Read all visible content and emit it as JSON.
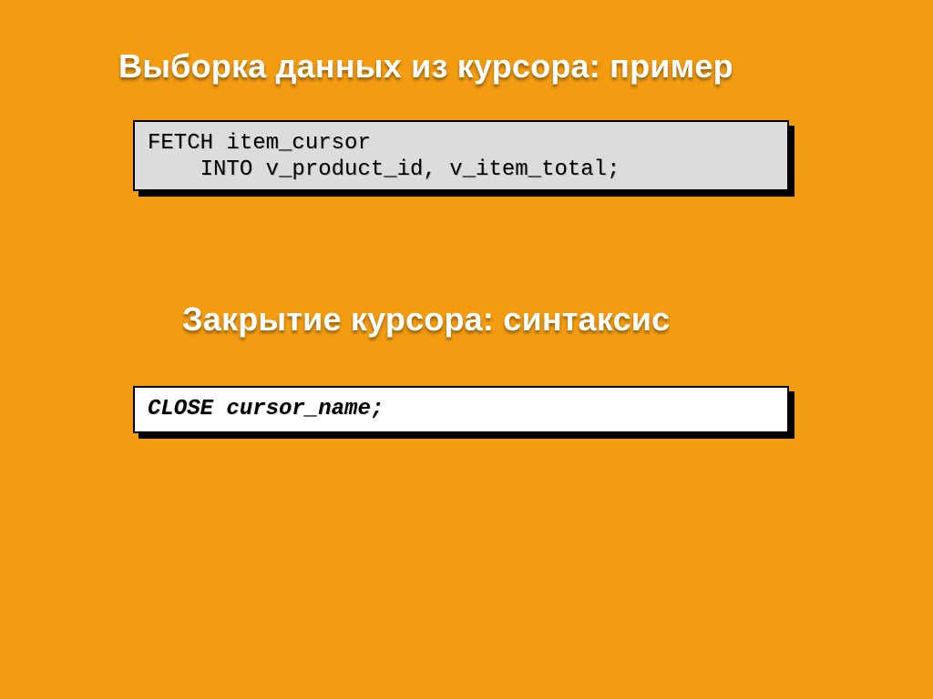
{
  "heading1": "Выборка данных из курсора: пример",
  "heading2": "Закрытие курсора: синтаксис",
  "code1_line1": "FETCH item_cursor",
  "code1_line2": "    INTO v_product_id, v_item_total;",
  "code2_line1": "CLOSE cursor_name;"
}
